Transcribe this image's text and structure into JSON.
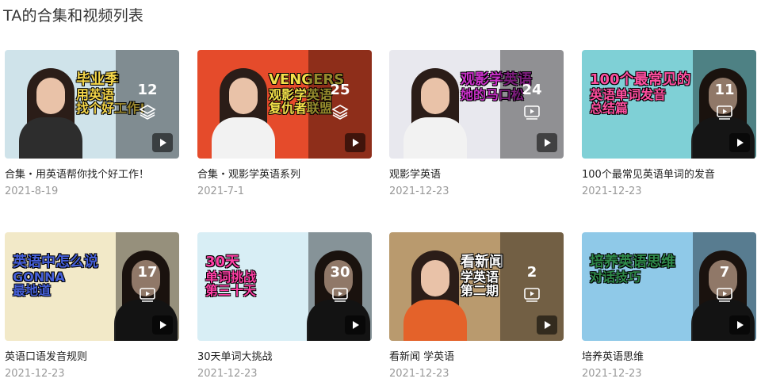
{
  "page": {
    "title": "TA的合集和视频列表"
  },
  "cards": [
    {
      "title": "合集・用英语帮你找个好工作！",
      "date": "2021-8-19",
      "count": "12",
      "kind": "collection",
      "sign_lines": [
        "毕业季",
        "用英语",
        "找个好工作!"
      ],
      "bg": "#cfe3ea",
      "accent": "#f4d64a",
      "shirt": "#2d2d2d"
    },
    {
      "title": "合集・观影学英语系列",
      "date": "2021-7-1",
      "count": "25",
      "kind": "collection",
      "sign_lines": [
        "VENGERS",
        "观影学英语",
        "复仇者联盟"
      ],
      "bg": "#e54b2b",
      "accent": "#f3e04a",
      "shirt": "#f2f2f2"
    },
    {
      "title": "观影学英语",
      "date": "2021-12-23",
      "count": "24",
      "kind": "video",
      "sign_lines": [
        "观影学英语",
        "她的马口松"
      ],
      "bg": "#e8e8ee",
      "accent": "#c830c8",
      "shirt": "#f2f2f2"
    },
    {
      "title": "100个最常见英语单词的发音",
      "date": "2021-12-23",
      "count": "11",
      "kind": "video",
      "sign_lines": [
        "100个最常见的",
        "英语单词发音",
        "总结篇"
      ],
      "bg": "#7fd0d6",
      "accent": "#ff4fa0",
      "shirt": "#222222"
    },
    {
      "title": "英语口语发音规则",
      "date": "2021-12-23",
      "count": "17",
      "kind": "video",
      "sign_lines": [
        "英语中怎么说",
        "GONNA",
        "最地道"
      ],
      "bg": "#f2e9c8",
      "accent": "#4660d8",
      "shirt": "#1f1f1f"
    },
    {
      "title": "30天单词大挑战",
      "date": "2021-12-23",
      "count": "30",
      "kind": "video",
      "sign_lines": [
        "30天",
        "单词挑战",
        "第三十天"
      ],
      "bg": "#d8eef5",
      "accent": "#ff3fa6",
      "shirt": "#1f1f1f"
    },
    {
      "title": "看新闻 学英语",
      "date": "2021-12-23",
      "count": "2",
      "kind": "video",
      "sign_lines": [
        "看新闻",
        "学英语",
        "第二期"
      ],
      "bg": "#b99a6e",
      "accent": "#ffffff",
      "shirt": "#e4622a"
    },
    {
      "title": "培养英语思维",
      "date": "2021-12-23",
      "count": "7",
      "kind": "video",
      "sign_lines": [
        "培养英语思维",
        "对话技巧"
      ],
      "bg": "#8fc9e8",
      "accent": "#2f8a4a",
      "shirt": "#1f1f1f"
    }
  ]
}
